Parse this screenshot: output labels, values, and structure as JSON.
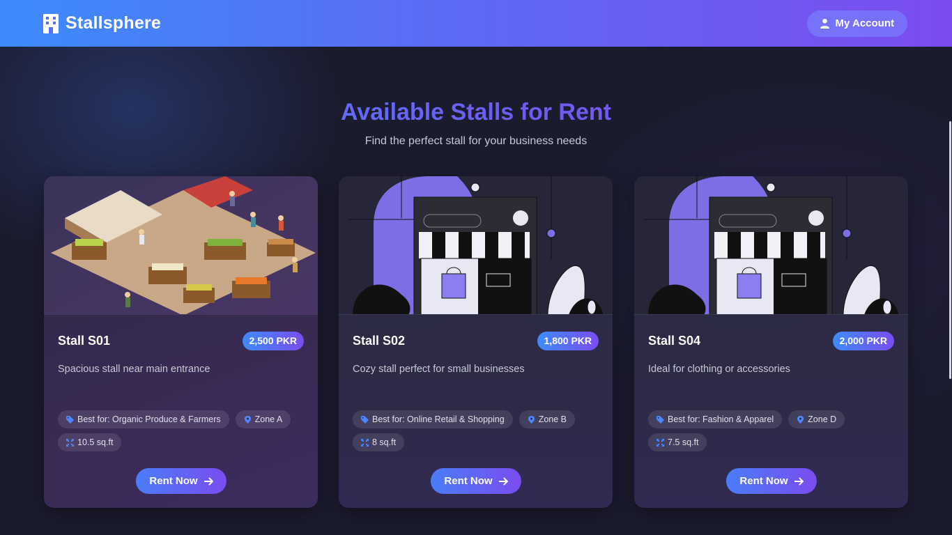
{
  "header": {
    "brand": "Stallsphere",
    "account_label": "My Account"
  },
  "hero": {
    "title": "Available Stalls for Rent",
    "subtitle": "Find the perfect stall for your business needs"
  },
  "stalls": [
    {
      "name": "Stall S01",
      "price": "2,500 PKR",
      "description": "Spacious stall near main entrance",
      "best_for": "Best for: Organic Produce & Farmers",
      "zone": "Zone A",
      "size": "10.5 sq.ft",
      "button": "Rent Now",
      "image": "market-illustration"
    },
    {
      "name": "Stall S02",
      "price": "1,800 PKR",
      "description": "Cozy stall perfect for small businesses",
      "best_for": "Best for: Online Retail & Shopping",
      "zone": "Zone B",
      "size": "8 sq.ft",
      "button": "Rent Now",
      "image": "storefront-illustration"
    },
    {
      "name": "Stall S04",
      "price": "2,000 PKR",
      "description": "Ideal for clothing or accessories",
      "best_for": "Best for: Fashion & Apparel",
      "zone": "Zone D",
      "size": "7.5 sq.ft",
      "button": "Rent Now",
      "image": "storefront-illustration"
    }
  ],
  "icons": {
    "brand": "building-icon",
    "account": "user-icon",
    "tag": "tag-icon",
    "zone": "map-pin-icon",
    "size": "expand-icon",
    "rent": "arrow-right-icon"
  },
  "colors": {
    "header_start": "#3d8bfd",
    "header_end": "#7b4cf0",
    "background": "#1b1b2e",
    "accent_blue": "#4d86ff",
    "accent_purple": "#8a4ef0"
  }
}
